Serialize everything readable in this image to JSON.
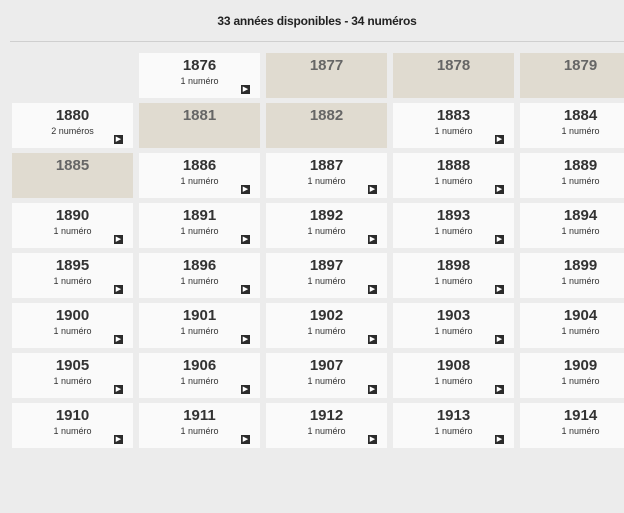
{
  "header": {
    "title": "33 années disponibles - 34 numéros"
  },
  "icons": {
    "arrow": "arrow-right-icon"
  },
  "colors": {
    "available": "#fafafa",
    "unavailable": "#e0dbd0",
    "arrow": "#2b2b2b"
  },
  "rows": [
    [
      {
        "empty": true
      },
      {
        "year": "1876",
        "count": "1 numéro",
        "available": true
      },
      {
        "year": "1877",
        "available": false
      },
      {
        "year": "1878",
        "available": false
      },
      {
        "year": "1879",
        "available": false
      }
    ],
    [
      {
        "year": "1880",
        "count": "2 numéros",
        "available": true
      },
      {
        "year": "1881",
        "available": false
      },
      {
        "year": "1882",
        "available": false
      },
      {
        "year": "1883",
        "count": "1 numéro",
        "available": true
      },
      {
        "year": "1884",
        "count": "1 numéro",
        "available": true
      }
    ],
    [
      {
        "year": "1885",
        "available": false
      },
      {
        "year": "1886",
        "count": "1 numéro",
        "available": true
      },
      {
        "year": "1887",
        "count": "1 numéro",
        "available": true
      },
      {
        "year": "1888",
        "count": "1 numéro",
        "available": true
      },
      {
        "year": "1889",
        "count": "1 numéro",
        "available": true
      }
    ],
    [
      {
        "year": "1890",
        "count": "1 numéro",
        "available": true
      },
      {
        "year": "1891",
        "count": "1 numéro",
        "available": true
      },
      {
        "year": "1892",
        "count": "1 numéro",
        "available": true
      },
      {
        "year": "1893",
        "count": "1 numéro",
        "available": true
      },
      {
        "year": "1894",
        "count": "1 numéro",
        "available": true
      }
    ],
    [
      {
        "year": "1895",
        "count": "1 numéro",
        "available": true
      },
      {
        "year": "1896",
        "count": "1 numéro",
        "available": true
      },
      {
        "year": "1897",
        "count": "1 numéro",
        "available": true
      },
      {
        "year": "1898",
        "count": "1 numéro",
        "available": true
      },
      {
        "year": "1899",
        "count": "1 numéro",
        "available": true
      }
    ],
    [
      {
        "year": "1900",
        "count": "1 numéro",
        "available": true
      },
      {
        "year": "1901",
        "count": "1 numéro",
        "available": true
      },
      {
        "year": "1902",
        "count": "1 numéro",
        "available": true
      },
      {
        "year": "1903",
        "count": "1 numéro",
        "available": true
      },
      {
        "year": "1904",
        "count": "1 numéro",
        "available": true
      }
    ],
    [
      {
        "year": "1905",
        "count": "1 numéro",
        "available": true
      },
      {
        "year": "1906",
        "count": "1 numéro",
        "available": true
      },
      {
        "year": "1907",
        "count": "1 numéro",
        "available": true
      },
      {
        "year": "1908",
        "count": "1 numéro",
        "available": true
      },
      {
        "year": "1909",
        "count": "1 numéro",
        "available": true
      }
    ],
    [
      {
        "year": "1910",
        "count": "1 numéro",
        "available": true
      },
      {
        "year": "1911",
        "count": "1 numéro",
        "available": true
      },
      {
        "year": "1912",
        "count": "1 numéro",
        "available": true
      },
      {
        "year": "1913",
        "count": "1 numéro",
        "available": true
      },
      {
        "year": "1914",
        "count": "1 numéro",
        "available": true
      }
    ]
  ]
}
